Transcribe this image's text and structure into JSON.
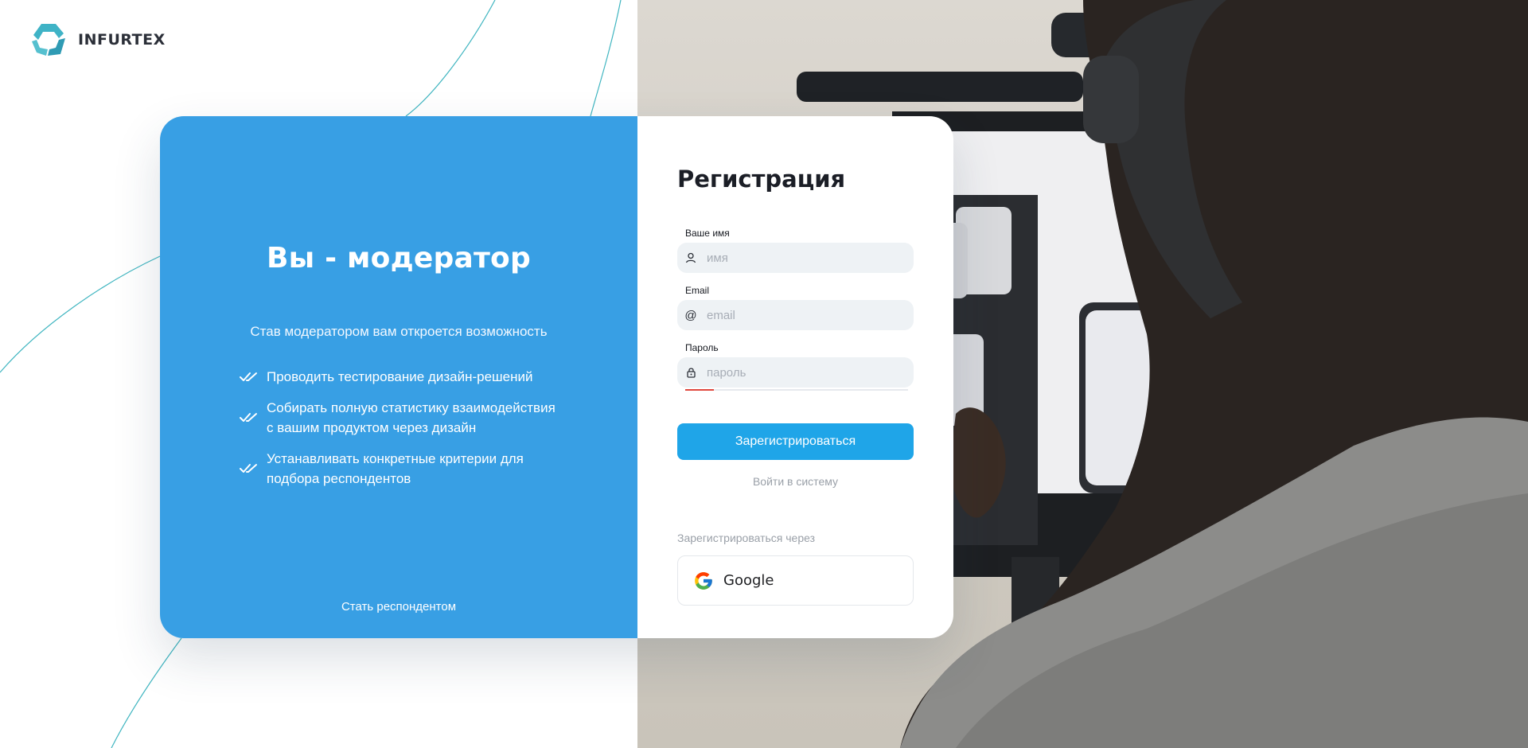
{
  "brand": {
    "name": "INFURTEX"
  },
  "promo": {
    "title": "Вы - модератор",
    "lead": "Став модератором вам откроется возможность",
    "benefits": [
      {
        "line1": "Проводить тестирование дизайн-решений",
        "line2": ""
      },
      {
        "line1": "Собирать полную статистику взаимодействия",
        "line2": "с вашим продуктом через дизайн"
      },
      {
        "line1": "Устанавливать конкретные критерии для",
        "line2": "подбора респондентов"
      }
    ],
    "footer_link": "Стать респондентом"
  },
  "form": {
    "title": "Регистрация",
    "fields": {
      "name": {
        "label": "Ваше имя",
        "placeholder": "имя",
        "value": "",
        "icon": "user-icon"
      },
      "email": {
        "label": "Email",
        "placeholder": "email",
        "value": "",
        "icon": "at-icon"
      },
      "password": {
        "label": "Пароль",
        "placeholder": "пароль",
        "value": "",
        "icon": "lock-icon"
      }
    },
    "password_strength": 0.13,
    "submit_label": "Зарегистрироваться",
    "login_link": "Войти в систему",
    "oauth_label": "Зарегистрироваться через",
    "google_label": "Google"
  },
  "colors": {
    "promo_bg": "#389fe4",
    "primary_button": "#1fa5e8",
    "strength_weak": "#e0473d",
    "logo_teal": "#3fb3c6"
  }
}
